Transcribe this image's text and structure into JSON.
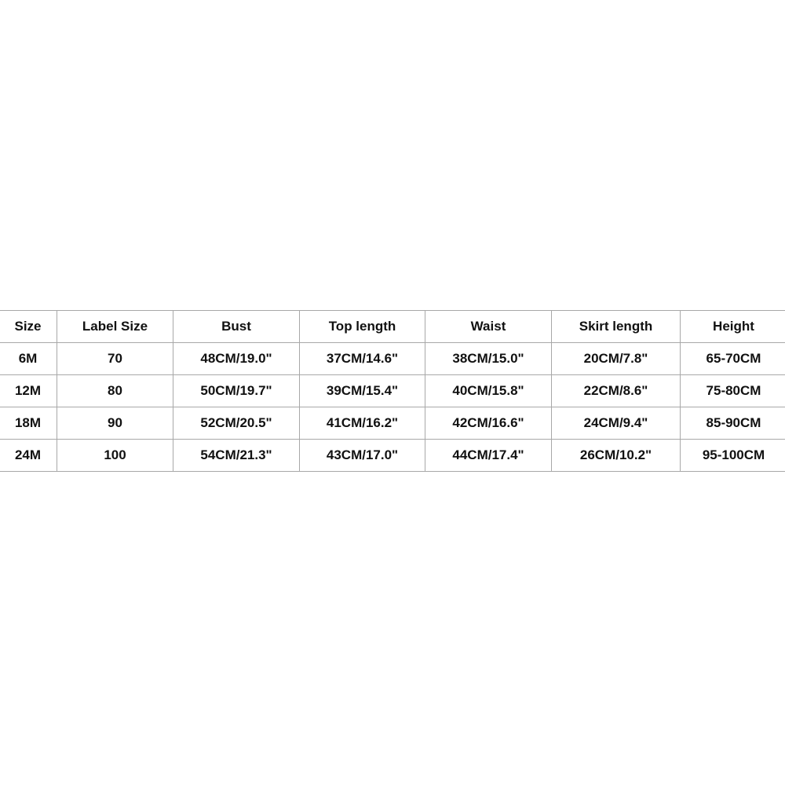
{
  "table": {
    "headers": [
      "Size",
      "Label Size",
      "Bust",
      "Top length",
      "Waist",
      "Skirt length",
      "Height"
    ],
    "rows": [
      [
        "6M",
        "70",
        "48CM/19.0\"",
        "37CM/14.6\"",
        "38CM/15.0\"",
        "20CM/7.8\"",
        "65-70CM"
      ],
      [
        "12M",
        "80",
        "50CM/19.7\"",
        "39CM/15.4\"",
        "40CM/15.8\"",
        "22CM/8.6\"",
        "75-80CM"
      ],
      [
        "18M",
        "90",
        "52CM/20.5\"",
        "41CM/16.2\"",
        "42CM/16.6\"",
        "24CM/9.4\"",
        "85-90CM"
      ],
      [
        "24M",
        "100",
        "54CM/21.3\"",
        "43CM/17.0\"",
        "44CM/17.4\"",
        "26CM/10.2\"",
        "95-100CM"
      ]
    ]
  },
  "colors": {
    "border": "#a8a8a8",
    "text": "#111111",
    "background": "#ffffff"
  }
}
